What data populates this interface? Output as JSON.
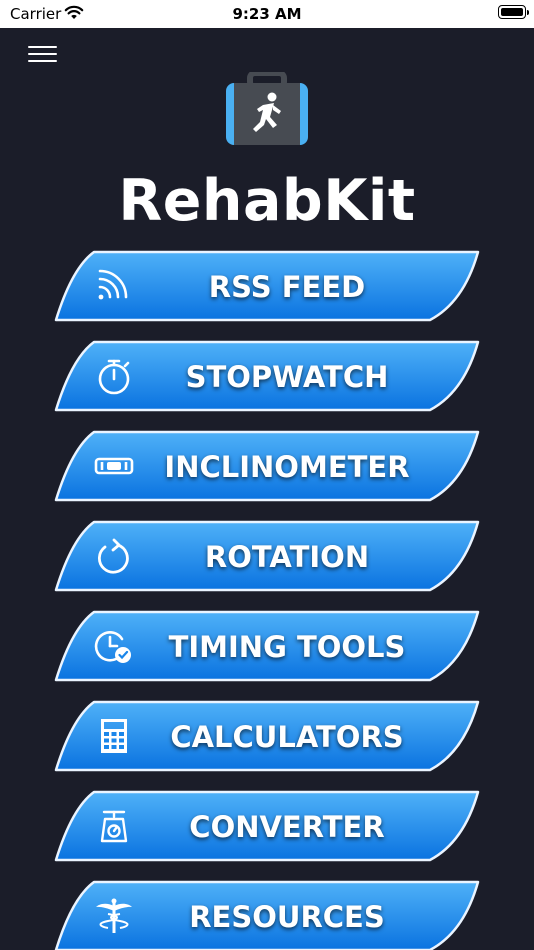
{
  "status_bar": {
    "carrier": "Carrier",
    "time": "9:23 AM"
  },
  "header": {
    "menu_icon": "hamburger-menu-icon",
    "logo_icon": "rehab-kit-bag-icon",
    "app_title": "RehabKit"
  },
  "menu": [
    {
      "label": "RSS FEED",
      "icon": "rss-icon"
    },
    {
      "label": "STOPWATCH",
      "icon": "stopwatch-icon"
    },
    {
      "label": "INCLINOMETER",
      "icon": "inclinometer-icon"
    },
    {
      "label": "ROTATION",
      "icon": "rotation-icon"
    },
    {
      "label": "TIMING TOOLS",
      "icon": "timing-tools-icon"
    },
    {
      "label": "CALCULATORS",
      "icon": "calculator-icon"
    },
    {
      "label": "CONVERTER",
      "icon": "scale-icon"
    },
    {
      "label": "RESOURCES",
      "icon": "caduceus-icon"
    }
  ],
  "colors": {
    "background": "#1b1d29",
    "button_light": "#4fb1f8",
    "button_dark": "#0a73e0",
    "button_border": "#eaf4ff",
    "logo_blue": "#4ab0f2",
    "logo_gray": "#474b52"
  }
}
